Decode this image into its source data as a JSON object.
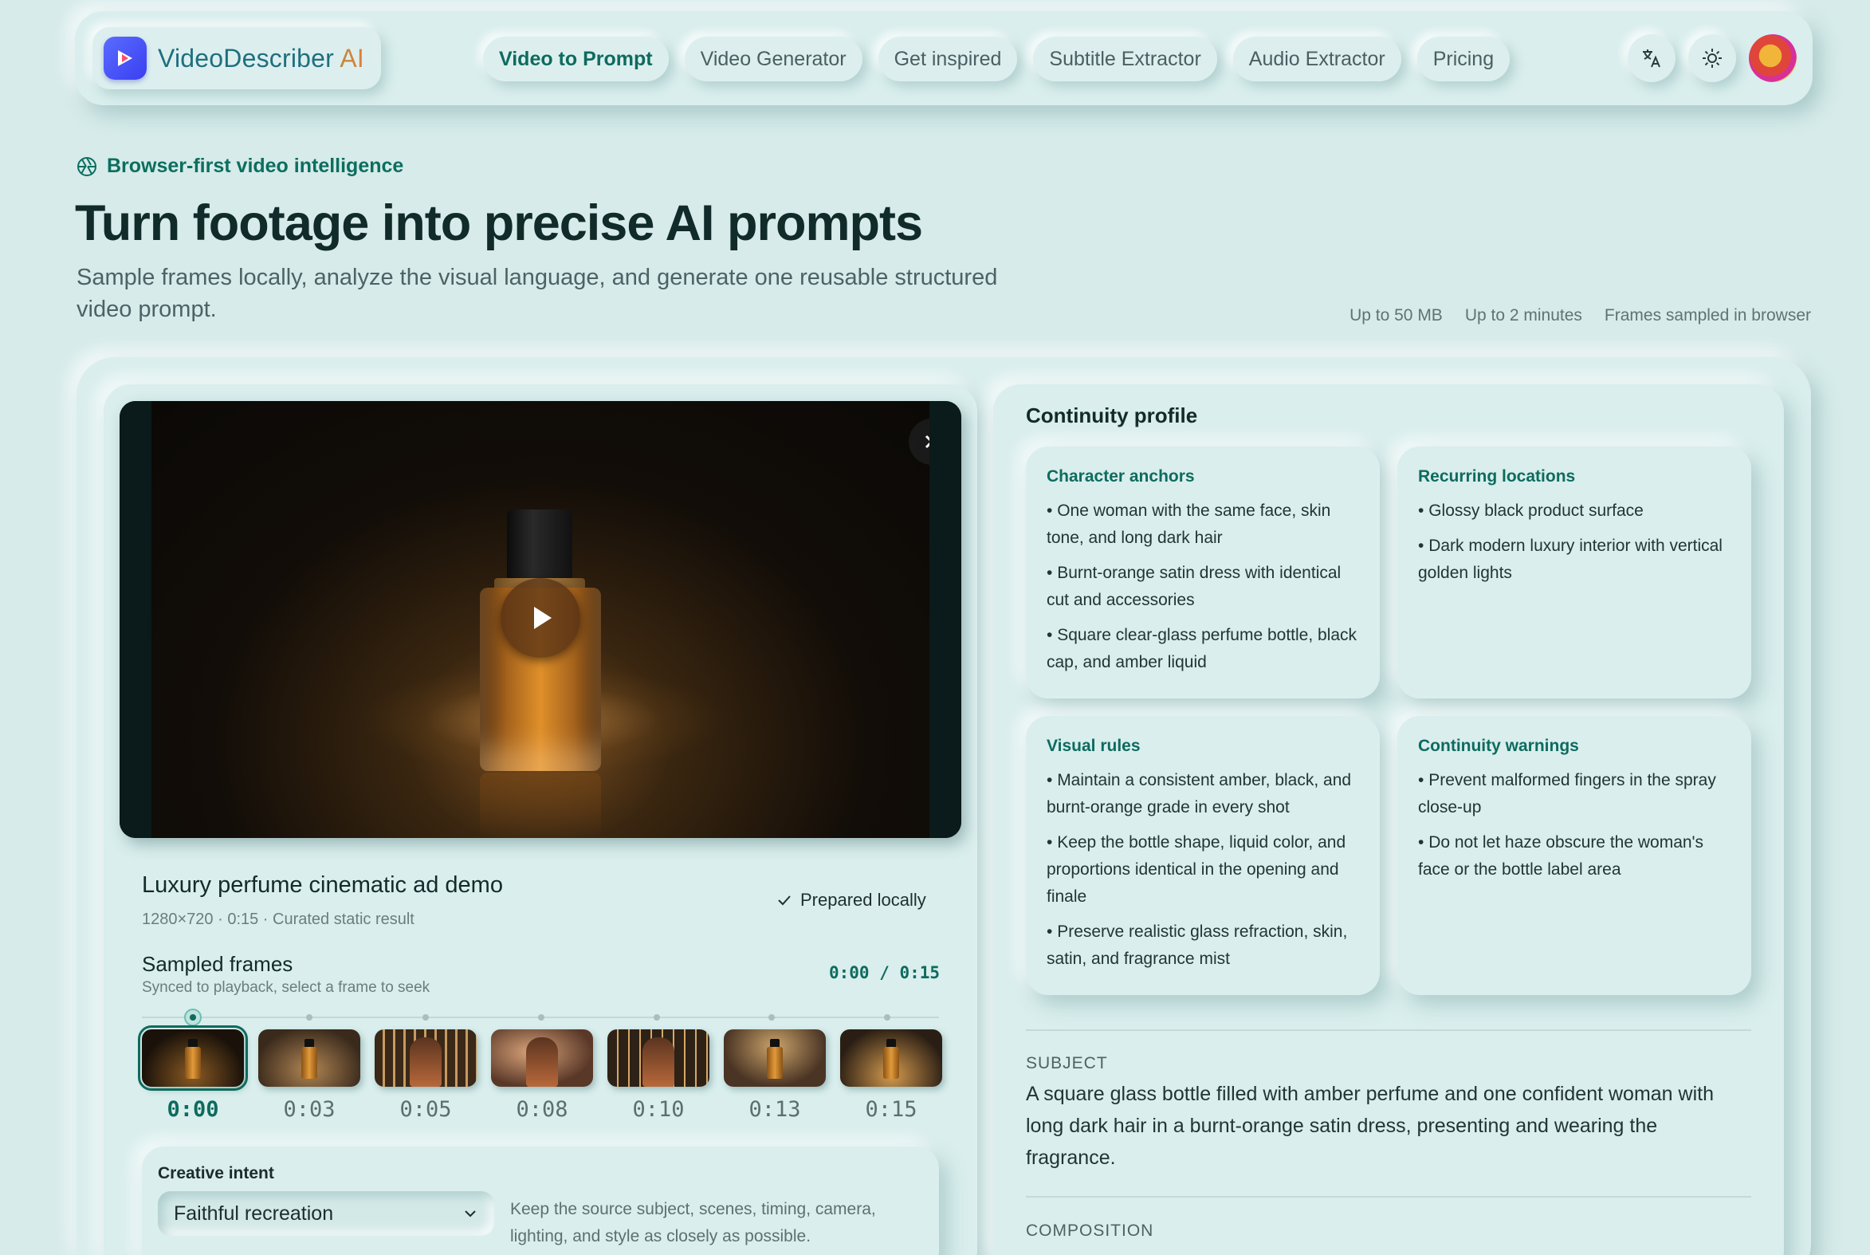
{
  "nav": {
    "brand_part1": "VideoDescriber",
    "brand_part2": "AI",
    "links": [
      "Video to Prompt",
      "Video Generator",
      "Get inspired",
      "Subtitle Extractor",
      "Audio Extractor",
      "Pricing"
    ],
    "active_link": "Video to Prompt",
    "icons": [
      "translate-icon",
      "sun-icon",
      "avatar"
    ]
  },
  "hero": {
    "eyebrow": "Browser-first video intelligence",
    "title": "Turn footage into precise AI prompts",
    "subtitle": "Sample frames locally, analyze the visual language, and generate one reusable structured video prompt.",
    "meta": [
      "Up to 50 MB",
      "Up to 2 minutes",
      "Frames sampled in browser"
    ]
  },
  "clip": {
    "title": "Luxury perfume cinematic ad demo",
    "meta": "1280×720 · 0:15 · Curated static result",
    "status": "Prepared locally"
  },
  "sampled_frames": {
    "title": "Sampled frames",
    "subtitle": "Synced to playback, select a frame to seek",
    "readout": "0:00 / 0:15",
    "times": [
      "0:00",
      "0:03",
      "0:05",
      "0:08",
      "0:10",
      "0:13",
      "0:15"
    ],
    "selected_index": 0
  },
  "intent": {
    "label": "Creative intent",
    "selected": "Faithful recreation",
    "description": "Keep the source subject, scenes, timing, camera, lighting, and style as closely as possible."
  },
  "continuity": {
    "title": "Continuity profile",
    "character": {
      "heading": "Character anchors",
      "items": [
        "One woman with the same face, skin tone, and long dark hair",
        "Burnt-orange satin dress with identical cut and accessories",
        "Square clear-glass perfume bottle, black cap, and amber liquid"
      ]
    },
    "locations": {
      "heading": "Recurring locations",
      "items": [
        "Glossy black product surface",
        "Dark modern luxury interior with vertical golden lights"
      ]
    },
    "visual": {
      "heading": "Visual rules",
      "items": [
        "Maintain a consistent amber, black, and burnt-orange grade in every shot",
        "Keep the bottle shape, liquid color, and proportions identical in the opening and finale",
        "Preserve realistic glass refraction, skin, satin, and fragrance mist"
      ]
    },
    "warnings": {
      "heading": "Continuity warnings",
      "items": [
        "Prevent malformed fingers in the spray close-up",
        "Do not let haze obscure the woman's face or the bottle label area"
      ]
    }
  },
  "prompt_sections": {
    "subject_label": "SUBJECT",
    "subject_text": "A square glass bottle filled with amber perfume and one confident woman with long dark hair in a burnt-orange satin dress, presenting and wearing the fragrance.",
    "composition_label": "COMPOSITION"
  },
  "colors": {
    "accent": "#0e6b5e",
    "background": "#d6ebea"
  }
}
